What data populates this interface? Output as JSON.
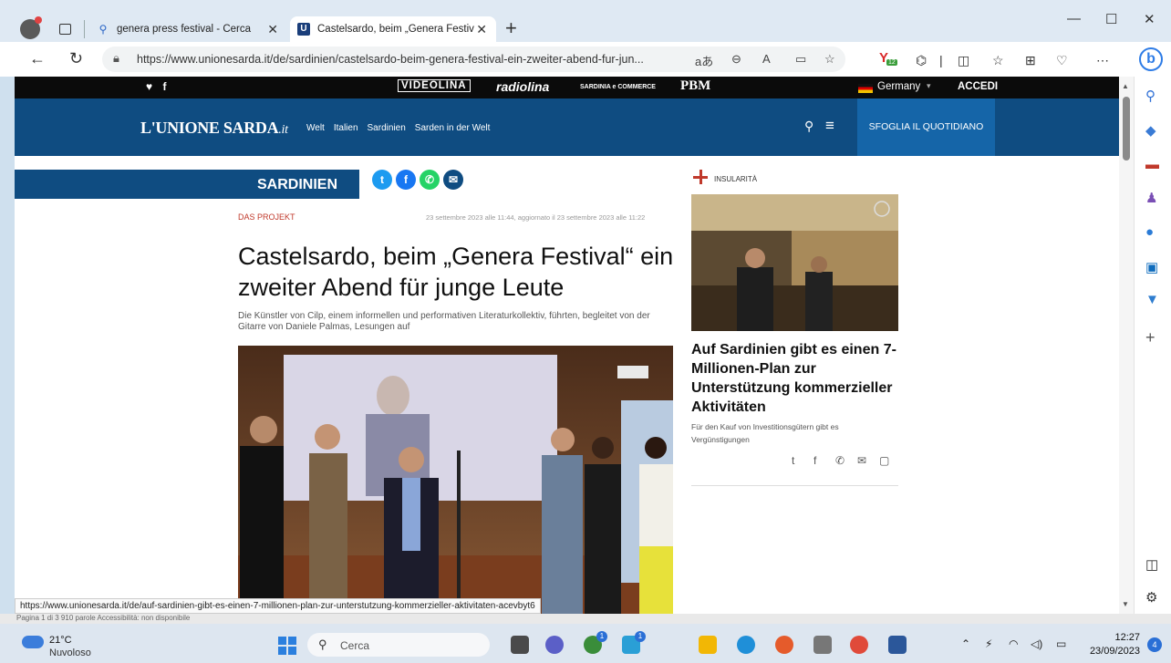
{
  "browser": {
    "tabs": [
      {
        "label": "genera press festival - Cerca"
      },
      {
        "label": "Castelsardo, beim „Genera Festiv"
      }
    ],
    "url": "https://www.unionesarda.it/de/sardinien/castelsardo-beim-genera-festival-ein-zweiter-abend-fur-jun...",
    "reading_mode_label": "aあ",
    "extension_badge": "12",
    "status_url": "https://www.unionesarda.it/de/auf-sardinien-gibt-es-einen-7-millionen-plan-zur-unterstutzung-kommerzieller-aktivitaten-acevbyt6",
    "status_under_text": "Pagina 1 di 3     910 parole     Accessibilità: non disponibile"
  },
  "site": {
    "topbar": {
      "social": "♥ f",
      "brands": [
        "VIDEOLINA",
        "radiolina",
        "SARDINIA e COMMERCE",
        "PBM"
      ],
      "country": "Germany",
      "login": "ACCEDI"
    },
    "logo": {
      "main": "L'UNIONE SARDA",
      "suffix": ".it"
    },
    "nav": [
      "Welt",
      "Italien",
      "Sardinien",
      "Sarden in der Welt"
    ],
    "sfoglia": "SFOGLIA IL QUOTIDIANO"
  },
  "article": {
    "section": "SARDINIEN",
    "kicker": "DAS PROJEKT",
    "date": "23 settembre 2023 alle 11:44, aggiornato il 23 settembre 2023 alle 11:22",
    "title": "Castelsardo, beim „Genera Festival“ ein zweiter Abend für junge Leute",
    "subtitle": "Die Künstler von Cilp, einem informellen und performativen Literaturkollektiv, führten, begleitet von der Gitarre von Daniele Palmas, Lesungen auf"
  },
  "sidebar_story": {
    "category": "INSULARITÀ",
    "title": "Auf Sardinien gibt es einen 7-Millionen-Plan zur Unterstützung kommerzieller Aktivitäten",
    "description": "Für den Kauf von Investitionsgütern gibt es Vergünstigungen"
  },
  "taskbar": {
    "temperature": "21°C",
    "weather": "Nuvoloso",
    "search_placeholder": "Cerca",
    "time": "12:27",
    "date": "23/09/2023",
    "notification_count": "4",
    "badge_a": "1",
    "badge_b": "1"
  },
  "colors": {
    "navy": "#0f4c81",
    "accent_red": "#c0392b"
  }
}
